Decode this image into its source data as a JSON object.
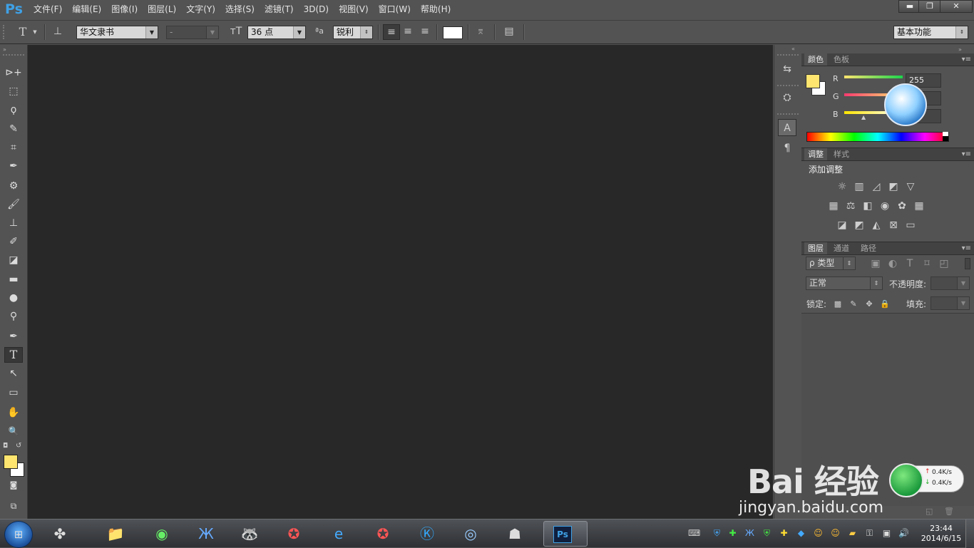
{
  "app": {
    "logo": "Ps"
  },
  "menu": [
    "文件(F)",
    "编辑(E)",
    "图像(I)",
    "图层(L)",
    "文字(Y)",
    "选择(S)",
    "滤镜(T)",
    "3D(D)",
    "视图(V)",
    "窗口(W)",
    "帮助(H)"
  ],
  "window_controls": {
    "minimize": "▬",
    "restore": "❐",
    "close": "✕"
  },
  "options": {
    "tool_glyph": "T",
    "font_family": "华文隶书",
    "font_style": "-",
    "font_size": "36 点",
    "aa_label": "ªa",
    "antialias": "锐利",
    "workspace": "基本功能"
  },
  "colors": {
    "foreground": "#fde56f",
    "background": "#ffffff",
    "canvas": "#282828",
    "accent": "#3fa1e6"
  },
  "color_panel": {
    "tabs": [
      "颜色",
      "色板"
    ],
    "labels": [
      "R",
      "G",
      "B"
    ],
    "r_value": "255"
  },
  "adjust_panel": {
    "tabs": [
      "调整",
      "样式"
    ],
    "title": "添加调整"
  },
  "layers_panel": {
    "tabs": [
      "图层",
      "通道",
      "路径"
    ],
    "filter_kind": "ρ 类型",
    "blend_mode": "正常",
    "opacity_label": "不透明度:",
    "lock_label": "锁定:",
    "fill_label": "填充:"
  },
  "overlay": {
    "upload_speed": "0.4K/s",
    "download_speed": "0.4K/s",
    "watermark_top": "Bai 经验",
    "watermark_bottom": "jingyan.baidu.com"
  },
  "taskbar": {
    "active_app": "Ps",
    "time": "23:44",
    "date": "2014/6/15"
  },
  "icons": {
    "move": "⊳+",
    "marquee": "⬚",
    "lasso": "ϙ",
    "quick_select": "✎",
    "crop": "⌗",
    "eyedropper": "✒",
    "heal": "⚙",
    "brush": "🖌",
    "stamp": "⊥",
    "history_brush": "✐",
    "eraser": "◪",
    "gradient": "▬",
    "blur": "●",
    "dodge": "⚲",
    "pen": "✒",
    "type": "T",
    "path_select": "↖",
    "shape": "▭",
    "hand": "✋",
    "zoom": "🔍"
  }
}
